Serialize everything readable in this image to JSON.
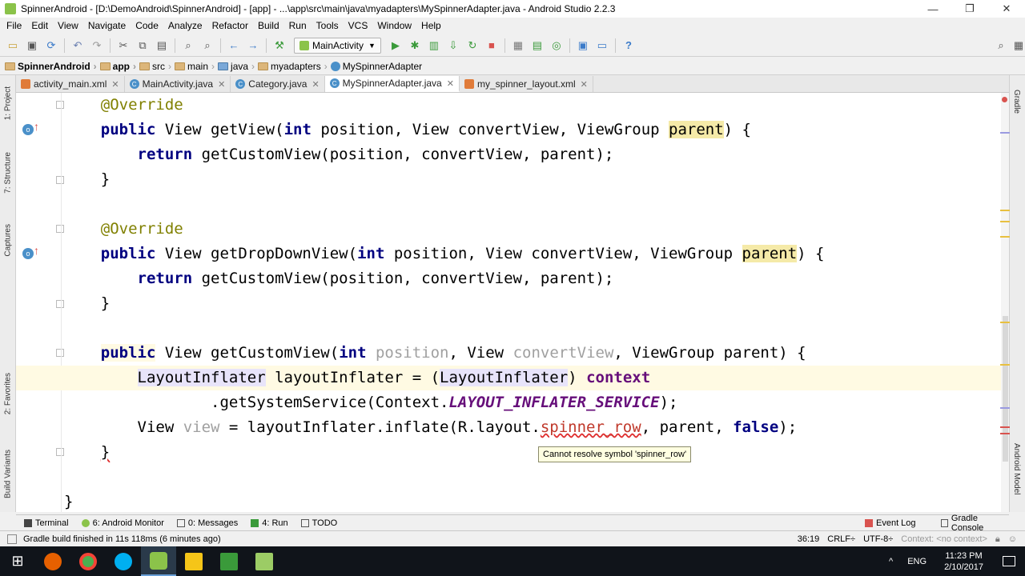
{
  "window": {
    "title": "SpinnerAndroid - [D:\\DemoAndroid\\SpinnerAndroid] - [app] - ...\\app\\src\\main\\java\\myadapters\\MySpinnerAdapter.java - Android Studio 2.2.3",
    "minimize": "—",
    "maximize": "❐",
    "close": "✕"
  },
  "menu": [
    "File",
    "Edit",
    "View",
    "Navigate",
    "Code",
    "Analyze",
    "Refactor",
    "Build",
    "Run",
    "Tools",
    "VCS",
    "Window",
    "Help"
  ],
  "toolbar": {
    "run_config": "MainActivity",
    "help": "?"
  },
  "breadcrumb": [
    "SpinnerAndroid",
    "app",
    "src",
    "main",
    "java",
    "myadapters",
    "MySpinnerAdapter"
  ],
  "tabs": [
    {
      "label": "activity_main.xml",
      "kind": "xml"
    },
    {
      "label": "MainActivity.java",
      "kind": "java"
    },
    {
      "label": "Category.java",
      "kind": "java"
    },
    {
      "label": "MySpinnerAdapter.java",
      "kind": "java",
      "active": true
    },
    {
      "label": "my_spinner_layout.xml",
      "kind": "xml"
    }
  ],
  "left_tools": [
    "1: Project",
    "7: Structure",
    "Captures",
    "2: Favorites",
    "Build Variants"
  ],
  "right_tools": [
    "Gradle",
    "Android Model"
  ],
  "code": {
    "l1_ann": "@Override",
    "l2_kw": "public",
    "l2_a": " View getView(",
    "l2_kw2": "int",
    "l2_b": " position, View convertView, ViewGroup ",
    "l2_param": "parent",
    "l2_c": ") {",
    "l3_kw": "return",
    "l3_a": " getCustomView(position, convertView, parent);",
    "l4": "}",
    "l5_ann": "@Override",
    "l6_kw": "public",
    "l6_a": " View getDropDownView(",
    "l6_kw2": "int",
    "l6_b": " position, View convertView, ViewGroup ",
    "l6_param": "parent",
    "l6_c": ") {",
    "l7_kw": "return",
    "l7_a": " getCustomView(position, convertView, parent);",
    "l8": "}",
    "l9_kw": "public",
    "l9_a": " View getCustomView(",
    "l9_kw2": "int",
    "l9_unused1": "position",
    "l9_b": ", View ",
    "l9_unused2": "convertView",
    "l9_c": ", ViewGroup parent) {",
    "l10_type1": "LayoutInflater",
    "l10_a": " layoutInflater = (",
    "l10_type2": "LayoutInflater",
    "l10_b": ") ",
    "l10_ctx": "context",
    "l11_a": ".getSystemService(Context.",
    "l11_static": "LAYOUT_INFLATER_SERVICE",
    "l11_b": ");",
    "l12_a": "View ",
    "l12_unused": "view",
    "l12_b": " = layoutInflater.inflate(R.layout.",
    "l12_err": "spinner_row",
    "l12_c": ", parent, ",
    "l12_kw": "false",
    "l12_d": ");",
    "l13": "}",
    "l14": "}"
  },
  "tooltip": "Cannot resolve symbol 'spinner_row'",
  "bottom_tools": {
    "terminal": "Terminal",
    "android_monitor": "6: Android Monitor",
    "messages": "0: Messages",
    "run": "4: Run",
    "todo": "TODO",
    "event_log": "Event Log",
    "gradle_console": "Gradle Console"
  },
  "status": {
    "message": "Gradle build finished in 11s 118ms (6 minutes ago)",
    "position": "36:19",
    "line_sep": "CRLF÷",
    "encoding": "UTF-8÷",
    "context": "Context: <no context>"
  },
  "taskbar": {
    "lang": "ENG",
    "time": "11:23 PM",
    "date": "2/10/2017"
  }
}
